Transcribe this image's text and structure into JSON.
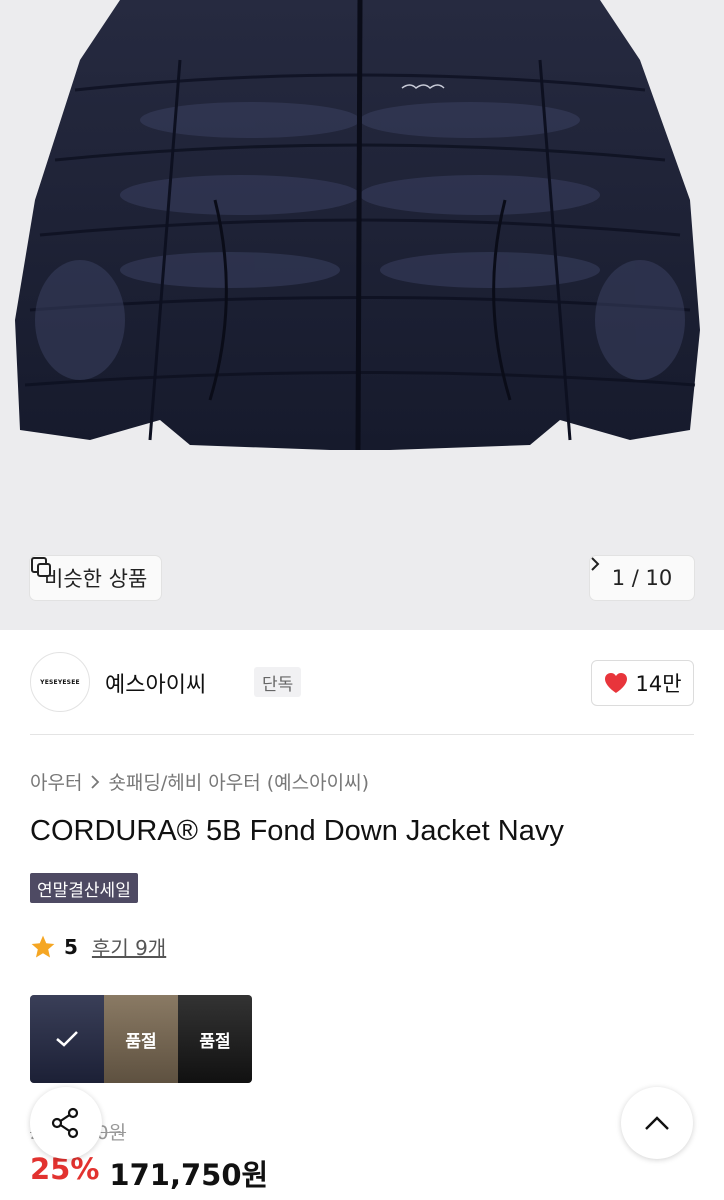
{
  "gallery": {
    "similar_label": "비슷한 상품",
    "counter": "1 / 10"
  },
  "brand": {
    "logo_text": "YESEYESEE",
    "name": "예스아이씨",
    "exclusive_badge": "단독",
    "like_count": "14만"
  },
  "breadcrumb": {
    "level1": "아우터",
    "level2": "숏패딩/헤비 아우터 (예스아이씨)"
  },
  "product": {
    "title": "CORDURA® 5B Fond Down Jacket Navy",
    "sale_badge": "연말결산세일",
    "rating": "5",
    "review_link": "후기 9개"
  },
  "options": [
    {
      "name": "navy",
      "status": "",
      "color": "#1c2036",
      "selected": true
    },
    {
      "name": "brown",
      "status": "품절",
      "color": "#6d5e4a",
      "selected": false
    },
    {
      "name": "black",
      "status": "품절",
      "color": "#151515",
      "selected": false
    }
  ],
  "pricing": {
    "original": "229,000원",
    "discount": "25%",
    "price": "171,750원"
  },
  "colors": {
    "heart": "#e8353b",
    "discount": "#e2322f",
    "sale_badge_bg": "#4e4a63"
  }
}
